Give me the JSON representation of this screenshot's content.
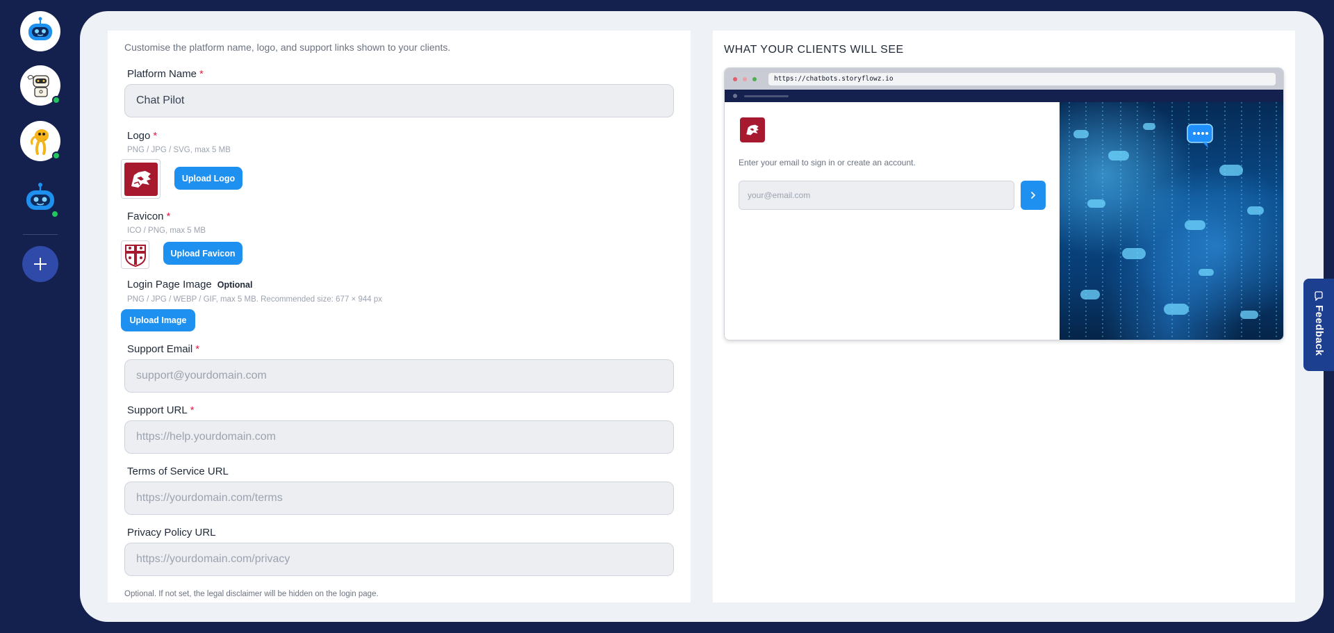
{
  "rail": {
    "bots": [
      {
        "name": "bot-avatar-1",
        "online": false
      },
      {
        "name": "bot-avatar-2",
        "online": true
      },
      {
        "name": "bot-avatar-3",
        "online": true
      },
      {
        "name": "bot-avatar-4",
        "online": true
      }
    ],
    "add_icon": "plus-icon"
  },
  "form": {
    "intro": "Customise the platform name, logo, and support links shown to your clients.",
    "platform_name": {
      "label": "Platform Name",
      "required": "*",
      "value": "Chat Pilot"
    },
    "logo": {
      "label": "Logo",
      "required": "*",
      "hint": "PNG / JPG / SVG, max 5 MB",
      "button": "Upload Logo"
    },
    "favicon": {
      "label": "Favicon",
      "required": "*",
      "hint": "ICO / PNG, max 5 MB",
      "button": "Upload Favicon"
    },
    "login_image": {
      "label": "Login Page Image",
      "optional": "Optional",
      "hint": "PNG / JPG / WEBP / GIF, max 5 MB. Recommended size: 677 × 944 px",
      "button": "Upload Image"
    },
    "support_email": {
      "label": "Support Email",
      "required": "*",
      "placeholder": "support@yourdomain.com"
    },
    "support_url": {
      "label": "Support URL",
      "required": "*",
      "placeholder": "https://help.yourdomain.com"
    },
    "terms_url": {
      "label": "Terms of Service URL",
      "placeholder": "https://yourdomain.com/terms"
    },
    "privacy_url": {
      "label": "Privacy Policy URL",
      "placeholder": "https://yourdomain.com/privacy"
    },
    "bottom_note": "Optional. If not set, the legal disclaimer will be hidden on the login page."
  },
  "preview": {
    "title": "WHAT YOUR CLIENTS WILL SEE",
    "url": "https://chatbots.storyflowz.io",
    "login_text": "Enter your email to sign in or create an account.",
    "email_placeholder": "your@email.com"
  },
  "feedback": {
    "label": "Feedback"
  },
  "colors": {
    "rail_bg": "#14214e",
    "accent": "#1e90f0",
    "required": "#e11d48",
    "logo_red": "#a6192e",
    "online": "#22c55e"
  }
}
